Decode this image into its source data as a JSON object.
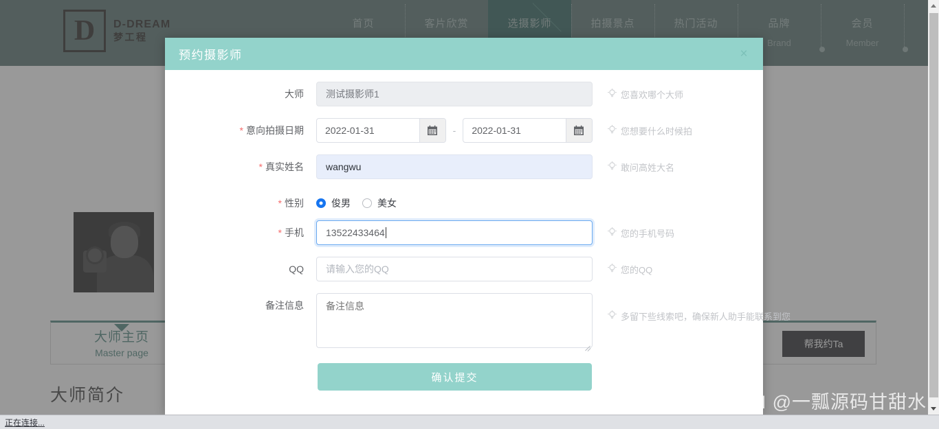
{
  "site": {
    "logo": {
      "glyph": "D",
      "en": "D-DREAM",
      "cn": "梦工程"
    },
    "nav": [
      {
        "cn": "首页",
        "en": ""
      },
      {
        "cn": "客片欣赏",
        "en": ""
      },
      {
        "cn": "选摄影师",
        "en": "",
        "active": true
      },
      {
        "cn": "拍摄景点",
        "en": ""
      },
      {
        "cn": "热门活动",
        "en": ""
      },
      {
        "cn": "品牌",
        "en": "Brand"
      },
      {
        "cn": "会员",
        "en": "Member"
      }
    ],
    "tab_master": {
      "cn": "大师主页",
      "en": "Master page"
    },
    "book_button": "帮我约Ta",
    "section_title": "大师简介"
  },
  "modal": {
    "title": "预约摄影师",
    "close_icon": "×",
    "fields": {
      "master": {
        "label": "大师",
        "required": false,
        "value": "测试摄影师1",
        "hint": "您喜欢哪个大师"
      },
      "date": {
        "label": "意向拍摄日期",
        "required": true,
        "start": "2022-01-31",
        "end": "2022-01-31",
        "separator": "-",
        "hint": "您想要什么时候拍"
      },
      "realname": {
        "label": "真实姓名",
        "required": true,
        "value": "wangwu",
        "hint": "敢问高姓大名"
      },
      "gender": {
        "label": "性别",
        "required": true,
        "options": [
          {
            "label": "俊男",
            "selected": true
          },
          {
            "label": "美女",
            "selected": false
          }
        ]
      },
      "phone": {
        "label": "手机",
        "required": true,
        "value": "13522433464",
        "hint": "您的手机号码",
        "focused": true
      },
      "qq": {
        "label": "QQ",
        "required": false,
        "value": "",
        "placeholder": "请输入您的QQ",
        "hint": "您的QQ"
      },
      "remark": {
        "label": "备注信息",
        "required": false,
        "value": "",
        "placeholder": "备注信息",
        "hint": "多留下些线索吧，确保新人助手能联系到您"
      }
    },
    "submit_label": "确认提交"
  },
  "browser": {
    "status_text": "正在连接..."
  },
  "watermark": "CSDN @一瓢源码甘甜水",
  "colors": {
    "header_green": "#486561",
    "nav_active": "#19534c",
    "modal_accent": "#93d3cb",
    "required_red": "#f56c6c",
    "radio_blue": "#1675f0",
    "book_btn_bg": "#16171b"
  }
}
